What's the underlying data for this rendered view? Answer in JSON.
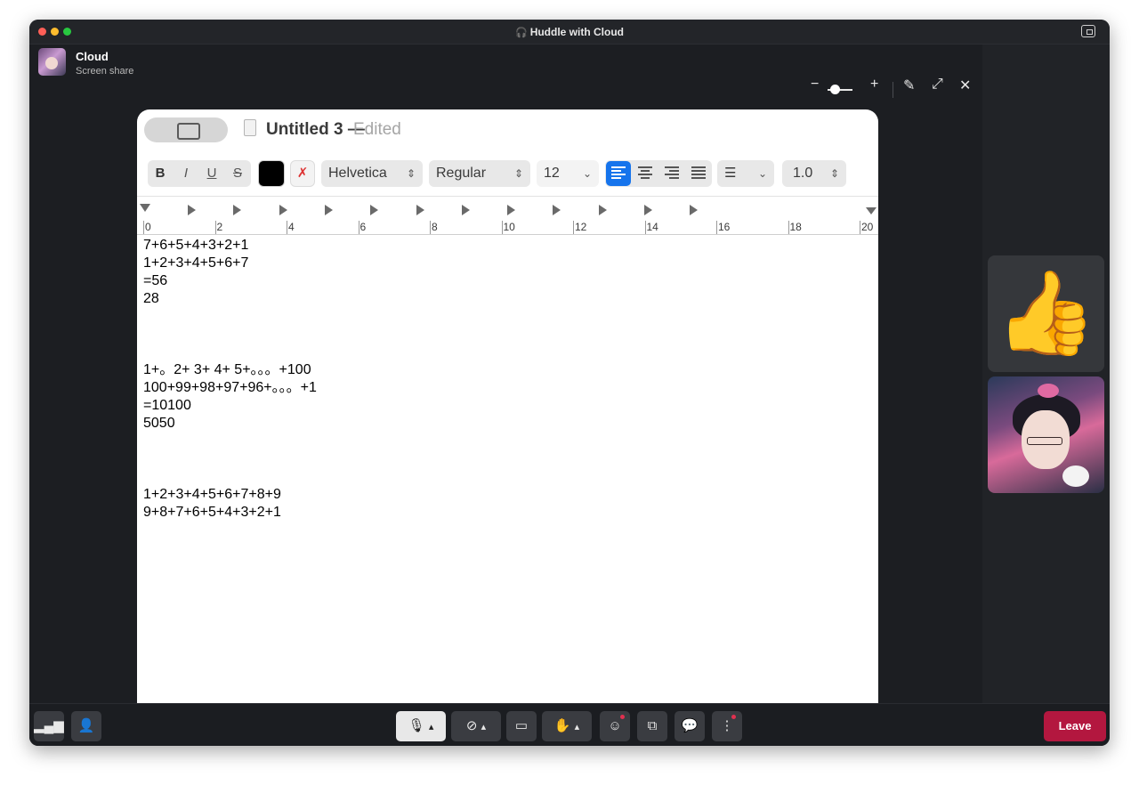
{
  "window": {
    "title": "Huddle with Cloud"
  },
  "presenter": {
    "name": "Cloud",
    "subtitle": "Screen share"
  },
  "document": {
    "title": "Untitled 3 —",
    "status": "Edited"
  },
  "format_bar": {
    "bold": "B",
    "italic": "I",
    "underline": "U",
    "strike": "S",
    "font_family": "Helvetica",
    "font_style": "Regular",
    "font_size": "12",
    "line_spacing": "1.0",
    "text_color": "#000000",
    "active_color": "#1674ec"
  },
  "ruler": {
    "labels": [
      "0",
      "2",
      "4",
      "6",
      "8",
      "10",
      "12",
      "14",
      "16",
      "18",
      "20"
    ]
  },
  "body_lines": [
    "7+6+5+4+3+2+1",
    "1+2+3+4+5+6+7",
    "=56",
    "28",
    "",
    "",
    "",
    "1+。2+ 3+ 4+ 5+。。。+100",
    "100+99+98+97+96+。。。+1",
    "=10100",
    "5050",
    "",
    "",
    "",
    "1+2+3+4+5+6+7+8+9",
    "9+8+7+6+5+4+3+2+1"
  ],
  "controls": {
    "leave_label": "Leave",
    "leave_color": "#b3173f"
  },
  "participants": [
    {
      "name": "thumbs-up-reaction",
      "icon": "👍"
    },
    {
      "name": "cloud-avatar"
    }
  ]
}
